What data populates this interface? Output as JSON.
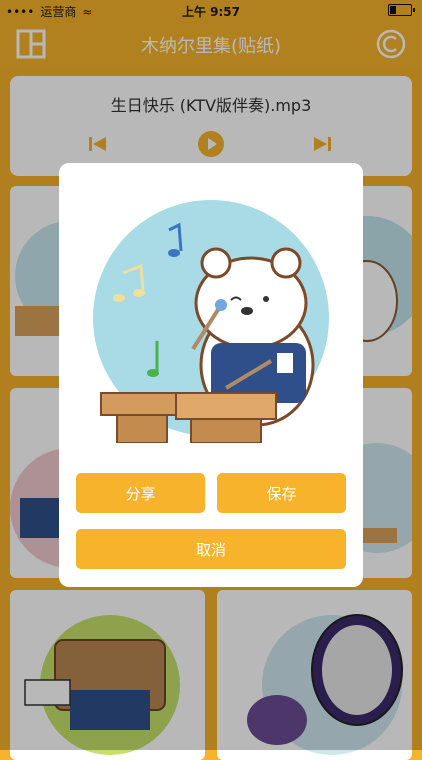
{
  "status_bar": {
    "carrier": "运营商",
    "time": "上午 9:57"
  },
  "nav": {
    "title": "木纳尔里集(贴纸)",
    "left_icon": "grid-layout-icon",
    "right_icon": "copyright-icon"
  },
  "player": {
    "song_title": "生日快乐 (KTV版伴奏).mp3"
  },
  "dialog": {
    "share_label": "分享",
    "save_label": "保存",
    "cancel_label": "取消"
  },
  "colors": {
    "brand": "#f7b32b",
    "button": "#f7b32b",
    "dialog": "#ffffff",
    "preview_circle": "#a8dbe6"
  }
}
